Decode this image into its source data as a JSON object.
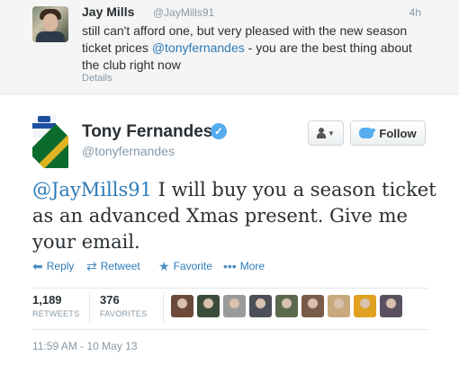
{
  "reply_tweet": {
    "name": "Jay Mills",
    "handle": "@JayMills91",
    "time": "4h",
    "text_before": "still can't afford one, but very pleased with the new season ticket prices ",
    "mention": "@tonyfernandes",
    "text_after": " - you are the best thing about the club right now",
    "details_label": "Details"
  },
  "main_tweet": {
    "name": "Tony Fernandes",
    "handle": "@tonyfernandes",
    "verified_glyph": "✓",
    "follow_label": "Follow",
    "mention": "@JayMills91",
    "text": " I will buy you a season ticket as an advanced Xmas present. Give me your email.",
    "actions": {
      "reply": "Reply",
      "retweet": "Retweet",
      "favorite": "Favorite",
      "more": "More"
    },
    "stats": {
      "retweets_count": "1,189",
      "retweets_label": "RETWEETS",
      "favorites_count": "376",
      "favorites_label": "FAVORITES"
    },
    "timestamp": "11:59 AM - 10 May 13"
  },
  "favoriter_avatars": [
    {
      "name": "avatar-1",
      "color": "#6b4a3a"
    },
    {
      "name": "avatar-2",
      "color": "#3b4d3a"
    },
    {
      "name": "avatar-3",
      "color": "#9a9a9a"
    },
    {
      "name": "avatar-4",
      "color": "#4c4f57"
    },
    {
      "name": "avatar-5",
      "color": "#5b6a4e"
    },
    {
      "name": "avatar-6",
      "color": "#7a5a48"
    },
    {
      "name": "avatar-7",
      "color": "#c8a97e"
    },
    {
      "name": "avatar-8",
      "color": "#e0a020"
    },
    {
      "name": "avatar-9",
      "color": "#5a5060"
    }
  ],
  "colors": {
    "link": "#2b7bb9",
    "muted": "#8899a6",
    "verified": "#55acee",
    "text": "#292f33"
  }
}
